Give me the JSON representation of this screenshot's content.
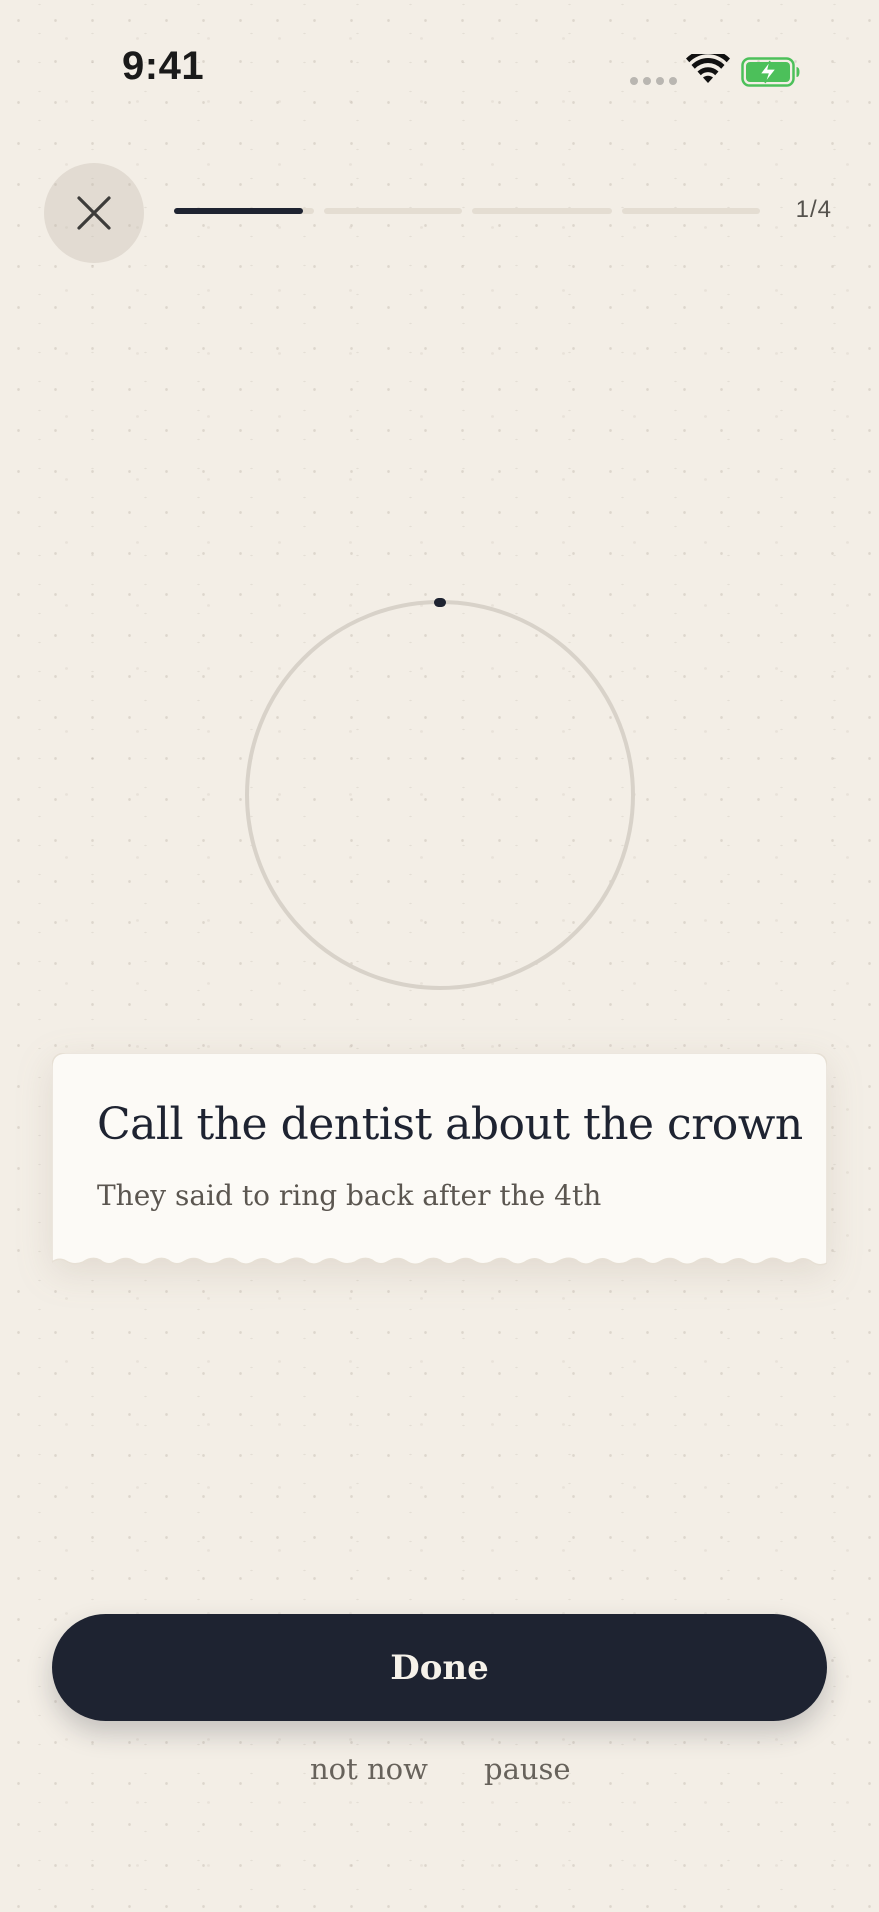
{
  "status_bar": {
    "time": "9:41",
    "icons": [
      "signal-dots-icon",
      "wifi-icon",
      "battery-charging-icon"
    ],
    "battery_color": "#4cc05a"
  },
  "header": {
    "close_icon": "close-icon",
    "progress": {
      "current": 1,
      "total": 4,
      "label": "1/4",
      "first_segment_fill": 0.92
    }
  },
  "timer": {
    "icon": "timer-ring",
    "elapsed_fraction": 0
  },
  "task": {
    "title": "Call the dentist about the crown",
    "note": "They said to ring back after the 4th"
  },
  "actions": {
    "done_label": "Done",
    "not_now_label": "not now",
    "pause_label": "pause"
  },
  "colors": {
    "background": "#f3eee6",
    "ink": "#1e2331",
    "card": "#fcfaf6",
    "muted": "#67625b"
  }
}
